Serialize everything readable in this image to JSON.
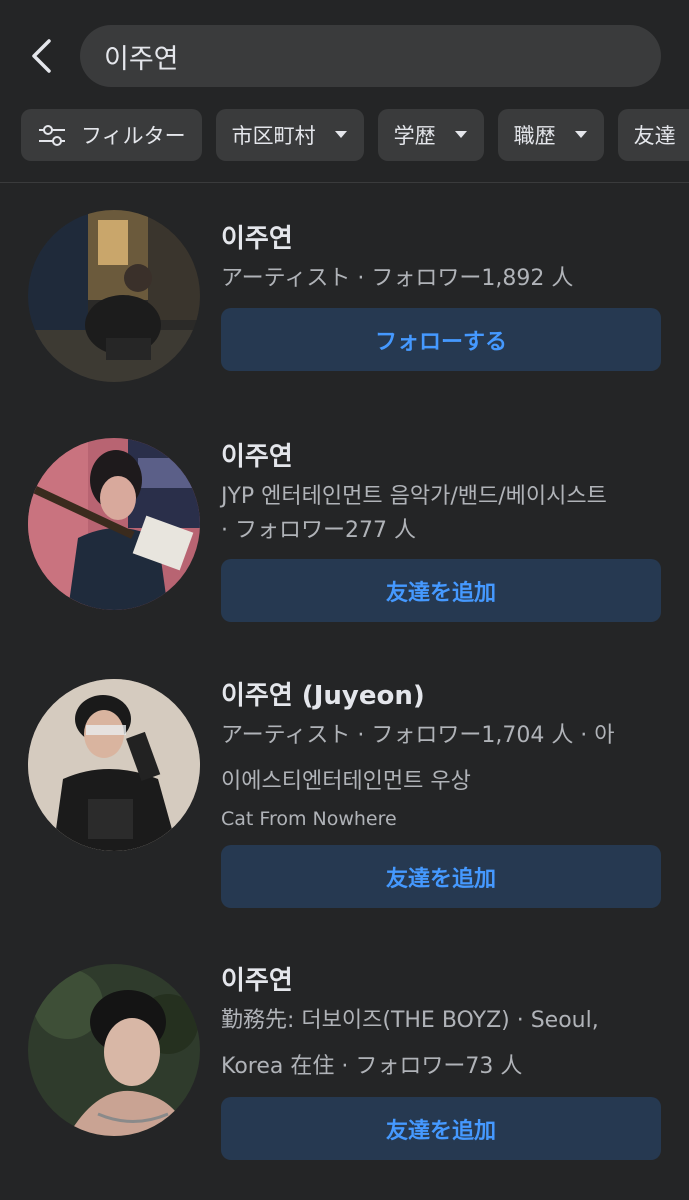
{
  "search": {
    "query": "이주연"
  },
  "filters": [
    {
      "label": "フィルター",
      "icon": "filter-sliders-icon"
    },
    {
      "label": "市区町村",
      "icon": "caret-down-icon"
    },
    {
      "label": "学歴",
      "icon": "caret-down-icon"
    },
    {
      "label": "職歴",
      "icon": "caret-down-icon"
    },
    {
      "label": "友達",
      "icon": "caret-down-icon"
    }
  ],
  "results": [
    {
      "name": "이주연",
      "line1": "アーティスト · フォロワー1,892 人",
      "action": "フォローする"
    },
    {
      "name": "이주연",
      "line1": "JYP 엔터테인먼트 음악가/밴드/베이시스트",
      "line2": "· フォロワー277 人",
      "action": "友達を追加"
    },
    {
      "name": "이주연 (Juyeon)",
      "line1": "アーティスト · フォロワー1,704 人 · 아",
      "line2": "이에스티엔터테인먼트 우상",
      "line3": "Cat From Nowhere",
      "action": "友達を追加"
    },
    {
      "name": "이주연",
      "line1": "勤務先: 더보이즈(THE BOYZ) · Seoul,",
      "line2": "Korea 在住 · フォロワー73 人",
      "action": "友達を追加"
    }
  ],
  "colors": {
    "background": "#242526",
    "surface": "#3a3b3c",
    "button_bg": "#263951",
    "accent": "#4599ff"
  }
}
